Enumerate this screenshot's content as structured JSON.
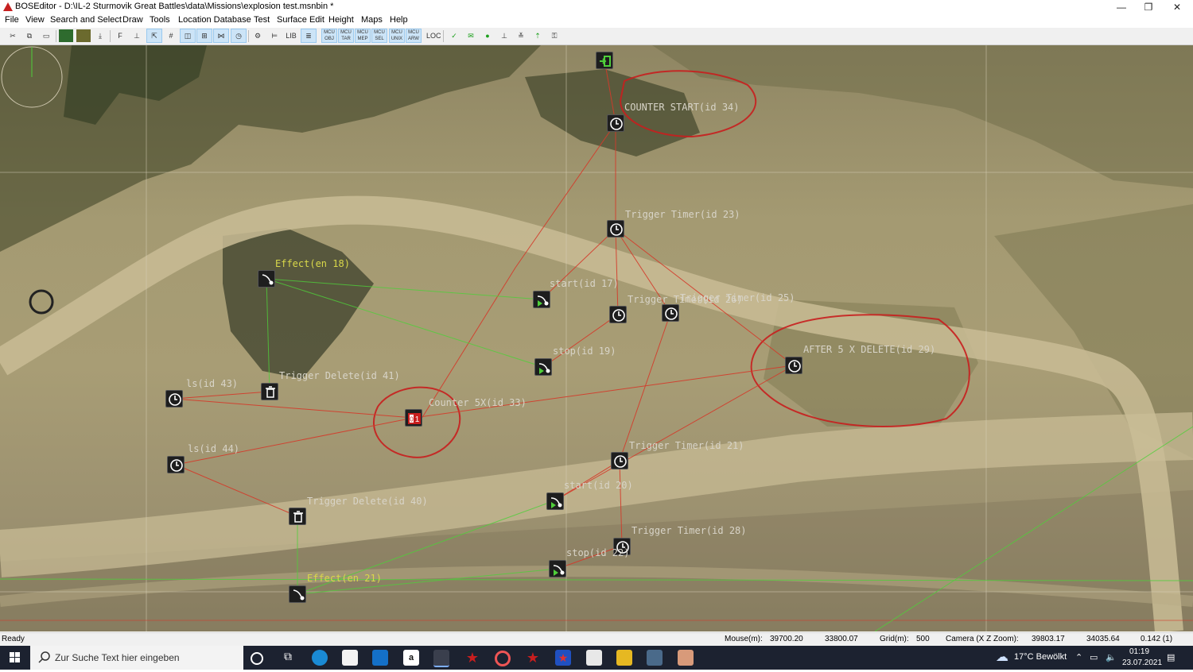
{
  "window": {
    "title": "BOSEditor - D:\\IL-2 Sturmovik Great Battles\\data\\Missions\\explosion test.msnbin *",
    "minimize": "—",
    "maximize": "❐",
    "close": "✕"
  },
  "menu": [
    "File",
    "View",
    "Search and Select",
    "Draw",
    "Tools",
    "Location Database",
    "Test",
    "Surface Edit",
    "Height",
    "Maps",
    "Help"
  ],
  "toolbar": {
    "buttons": [
      "cut-icon",
      "copy-icon",
      "paste-icon",
      "map-icon",
      "map2-icon",
      "download-icon",
      "F",
      "group-icon",
      "select-icon",
      "grid-icon",
      "split-icon",
      "waypoint-icon",
      "route-icon",
      "clock-icon",
      "gear-icon",
      "align-icon",
      "LIB",
      "list-icon",
      "MCU OBJ",
      "MCU TAR",
      "MCU MEP",
      "MCU SEL",
      "MCU UNIX",
      "MCU ARW",
      "LOC",
      "check-icon",
      "mail-icon",
      "dot-icon",
      "level-icon",
      "level2-icon",
      "arrow-up-icon",
      "key-icon"
    ],
    "text_labels": {
      "f": "F",
      "lib": "LIB",
      "loc": "LOC"
    }
  },
  "map": {
    "nodes": [
      {
        "label": "COUNTER START(id 34)",
        "type": "timer"
      },
      {
        "label": "Trigger Timer(id 23)",
        "type": "timer"
      },
      {
        "label": "Effect(en 18)",
        "type": "effect"
      },
      {
        "label": "start(id 17)",
        "type": "start"
      },
      {
        "label": "Trigger Timer(id 26)",
        "type": "timer"
      },
      {
        "label": "Trigger Timer(id 25)",
        "type": "timer"
      },
      {
        "label": "stop(id 19)",
        "type": "stop"
      },
      {
        "label": "AFTER 5 X DELETE(id 29)",
        "type": "timer"
      },
      {
        "label": "Trigger Delete(id 41)",
        "type": "delete"
      },
      {
        "label": "ls(id 43)",
        "type": "timer"
      },
      {
        "label": "Counter 5X(id 33)",
        "type": "counter"
      },
      {
        "label": "ls(id 44)",
        "type": "timer"
      },
      {
        "label": "Trigger Timer(id 21)",
        "type": "timer"
      },
      {
        "label": "start(id 20)",
        "type": "start"
      },
      {
        "label": "Trigger Delete(id 40)",
        "type": "delete"
      },
      {
        "label": "Trigger Timer(id 28)",
        "type": "timer"
      },
      {
        "label": "stop(id 22)",
        "type": "stop"
      },
      {
        "label": "Effect(en 21)",
        "type": "effect"
      }
    ]
  },
  "status": {
    "ready": "Ready",
    "mouse_label": "Mouse(m):",
    "mouse_x": "39700.20",
    "mouse_z": "33800.07",
    "grid_label": "Grid(m):",
    "grid": "500",
    "camera_label": "Camera (X Z Zoom):",
    "camera_x": "39803.17",
    "camera_z": "34035.64",
    "zoom": "0.142 (1)"
  },
  "taskbar": {
    "search_placeholder": "Zur Suche Text hier eingeben",
    "weather": "17°C  Bewölkt",
    "time": "01:19",
    "date": "23.07.2021"
  },
  "colors": {
    "link": "#d43a2a",
    "green_link": "#4fcf3a",
    "counter": "#c81e1e"
  }
}
